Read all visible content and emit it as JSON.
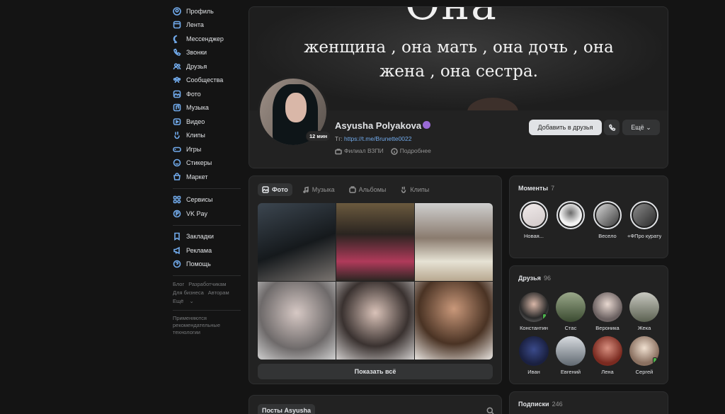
{
  "sidebar": {
    "items": [
      {
        "label": "Профиль",
        "icon": "profile-icon"
      },
      {
        "label": "Лента",
        "icon": "feed-icon"
      },
      {
        "label": "Мессенджер",
        "icon": "messenger-icon"
      },
      {
        "label": "Звонки",
        "icon": "phone-icon"
      },
      {
        "label": "Друзья",
        "icon": "friends-icon"
      },
      {
        "label": "Сообщества",
        "icon": "communities-icon"
      },
      {
        "label": "Фото",
        "icon": "photo-icon"
      },
      {
        "label": "Музыка",
        "icon": "music-icon"
      },
      {
        "label": "Видео",
        "icon": "video-icon"
      },
      {
        "label": "Клипы",
        "icon": "clips-icon"
      },
      {
        "label": "Игры",
        "icon": "games-icon"
      },
      {
        "label": "Стикеры",
        "icon": "stickers-icon"
      },
      {
        "label": "Маркет",
        "icon": "market-icon"
      }
    ],
    "items2": [
      {
        "label": "Сервисы",
        "icon": "services-icon"
      },
      {
        "label": "VK Pay",
        "icon": "vkpay-icon"
      }
    ],
    "items3": [
      {
        "label": "Закладки",
        "icon": "bookmarks-icon"
      },
      {
        "label": "Реклама",
        "icon": "ads-icon"
      },
      {
        "label": "Помощь",
        "icon": "help-icon"
      }
    ],
    "footer": {
      "blog": "Блог",
      "developers": "Разработчикам",
      "business": "Для бизнеса",
      "authors": "Авторам",
      "more": "Ещё",
      "note": "Применяются рекомендательные технологии"
    }
  },
  "profile": {
    "cover_big": "Она",
    "cover_line1": "женщина , она мать , она дочь , она",
    "cover_line2": "жена , она сестра.",
    "last_seen": "12 мин",
    "name": "Asyusha Polyakova",
    "tg_prefix": "Tг:",
    "tg_link": "https://t.me/Brunette0022",
    "org": "Филиал ВЗПИ",
    "details": "Подробнее",
    "add_friend": "Добавить в друзья",
    "more": "Ещё"
  },
  "media": {
    "tabs": [
      {
        "label": "Фото",
        "icon": "photo-icon"
      },
      {
        "label": "Музыка",
        "icon": "music-icon"
      },
      {
        "label": "Альбомы",
        "icon": "albums-icon"
      },
      {
        "label": "Клипы",
        "icon": "clips-icon"
      }
    ],
    "show_all": "Показать всё"
  },
  "moments": {
    "title": "Моменты",
    "count": "7",
    "items": [
      {
        "label": "Новая..."
      },
      {
        "label": ""
      },
      {
        "label": "Весело"
      },
      {
        "label": "+ФПро куратура..."
      }
    ]
  },
  "friends": {
    "title": "Друзья",
    "count": "96",
    "items": [
      {
        "name": "Константин"
      },
      {
        "name": "Стас"
      },
      {
        "name": "Вероника"
      },
      {
        "name": "Жека"
      },
      {
        "name": "Иван"
      },
      {
        "name": "Евгений"
      },
      {
        "name": "Лена"
      },
      {
        "name": "Сергей"
      }
    ]
  },
  "subscriptions": {
    "title": "Подписки",
    "count": "246"
  },
  "posts": {
    "tab": "Посты Asyusha"
  }
}
